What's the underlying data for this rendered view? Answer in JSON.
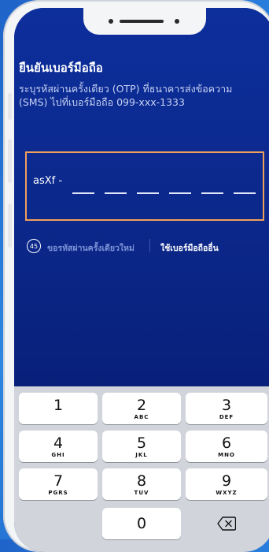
{
  "header": {
    "title": "ยืนยันเบอร์มือถือ",
    "subtitle": "ระบุรหัสผ่านครั้งเดียว (OTP) ที่ธนาคารส่งข้อความ (SMS) ไปที่เบอร์มือถือ 099-xxx-1333"
  },
  "otp": {
    "prefix": "asXf -",
    "digits": [
      "",
      "",
      "",
      "",
      "",
      ""
    ]
  },
  "resend": {
    "countdown": "45",
    "label": "ขอรหัสผ่านครั้งเดียวใหม่",
    "other_number": "ใช้เบอร์มือถืออื่น"
  },
  "keypad": {
    "keys": [
      {
        "num": "1",
        "letters": ""
      },
      {
        "num": "2",
        "letters": "ABC"
      },
      {
        "num": "3",
        "letters": "DEF"
      },
      {
        "num": "4",
        "letters": "GHI"
      },
      {
        "num": "5",
        "letters": "JKL"
      },
      {
        "num": "6",
        "letters": "MNO"
      },
      {
        "num": "7",
        "letters": "PGRS"
      },
      {
        "num": "8",
        "letters": "TUV"
      },
      {
        "num": "9",
        "letters": "WXYZ"
      },
      {
        "num": "0",
        "letters": ""
      }
    ],
    "backspace_icon": "backspace-icon"
  },
  "colors": {
    "screen_blue": "#0d2f9c",
    "otp_border": "#f0a05a",
    "keypad_bg": "#d1d4da"
  }
}
